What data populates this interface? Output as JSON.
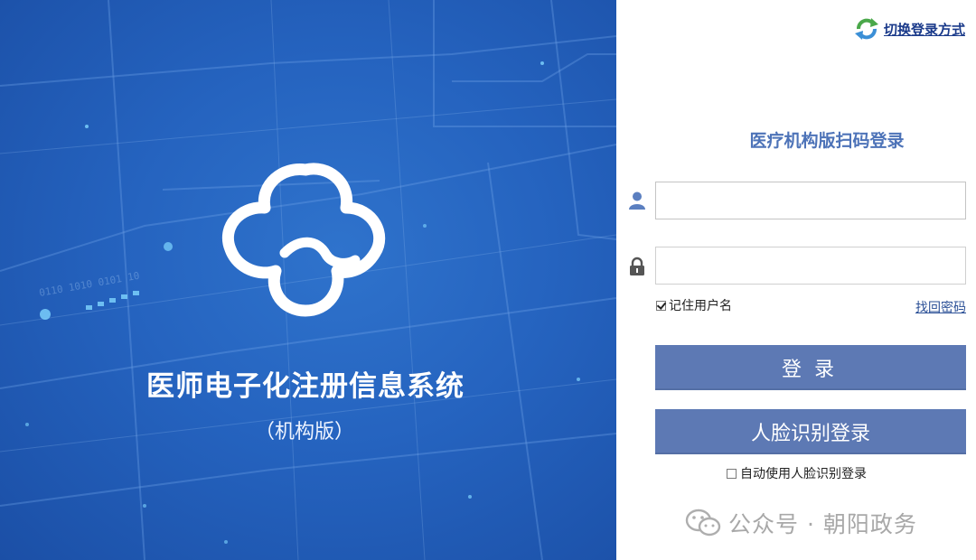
{
  "hero": {
    "system_title": "医师电子化注册信息系统",
    "system_subtitle": "（机构版）",
    "logo_icon": "cloud-logo-icon",
    "background_color": "#2563bf"
  },
  "panel": {
    "switch_link": "切换登录方式",
    "switch_icon": "refresh-arrows-icon",
    "login_title": "医疗机构版扫码登录",
    "username": {
      "icon": "user-icon",
      "value": "",
      "placeholder": ""
    },
    "password": {
      "icon": "lock-icon",
      "value": "",
      "placeholder": ""
    },
    "remember_label": "记住用户名",
    "remember_checked": true,
    "forgot_link": "找回密码",
    "login_button": "登录",
    "face_button": "人脸识别登录",
    "auto_face_label": "自动使用人脸识别登录",
    "auto_face_checked": false,
    "button_color": "#5d79b4",
    "title_color": "#4d73b8"
  },
  "watermark": {
    "text": "公众号 · 朝阳政务",
    "icon": "wechat-icon"
  }
}
